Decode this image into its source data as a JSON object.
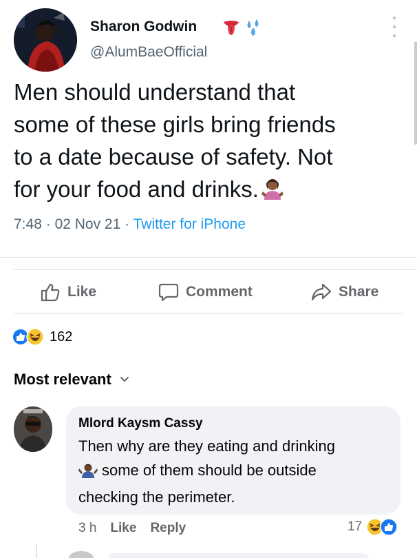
{
  "tweet": {
    "display_name": "Sharon Godwin",
    "handle": "@AlumBaeOfficial",
    "text_lines": [
      "Men should understand that",
      "some of these girls bring friends",
      "to a date because of safety. Not",
      "for your food and drinks."
    ],
    "time": "7:48",
    "date": "02 Nov 21",
    "source": "Twitter for iPhone",
    "separator": "·",
    "name_emojis": [
      "tongue-emoji",
      "sweat-droplets-emoji"
    ],
    "text_end_emoji": "person-shrugging-emoji"
  },
  "actions": {
    "like": "Like",
    "comment": "Comment",
    "share": "Share"
  },
  "reactions": {
    "count": "162",
    "types": [
      "like",
      "haha"
    ]
  },
  "sort": {
    "label": "Most relevant"
  },
  "comment": {
    "author": "Mlord Kaysm Cassy",
    "text_lines": [
      "Then why are they eating and drinking",
      "some of them should be outside",
      "checking the perimeter."
    ],
    "inline_emoji": "person-gesturing-emoji",
    "time": "3 h",
    "like": "Like",
    "reply": "Reply",
    "reaction_count": "17",
    "reaction_types": [
      "haha",
      "like"
    ]
  },
  "colors": {
    "twitter_blue": "#1d9bf0",
    "fb_blue": "#1877f2",
    "muted": "#536471",
    "fb_muted": "#65676b",
    "bubble": "#f0f2f5"
  }
}
